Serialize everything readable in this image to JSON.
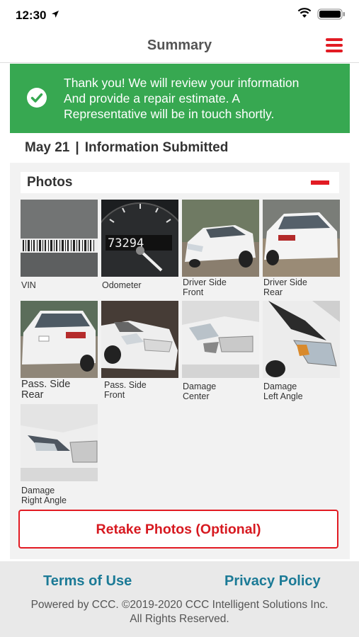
{
  "status_bar": {
    "time": "12:30"
  },
  "nav": {
    "title": "Summary"
  },
  "banner": {
    "lines": [
      "Thank you! We will review your information",
      "And provide a repair estimate. A",
      "Representative will be in touch shortly."
    ]
  },
  "submission": {
    "date": "May 21",
    "separator": "|",
    "status": "Information Submitted"
  },
  "photos": {
    "title": "Photos",
    "items": [
      {
        "line1": "VIN",
        "line2": ""
      },
      {
        "line1": "Odometer",
        "line2": ""
      },
      {
        "line1": "Driver Side",
        "line2": "Front"
      },
      {
        "line1": "Driver Side",
        "line2": "Rear"
      },
      {
        "line1": "Pass. Side",
        "line2": "Rear"
      },
      {
        "line1": "Pass. Side",
        "line2": "Front"
      },
      {
        "line1": "Damage",
        "line2": "Center"
      },
      {
        "line1": "Damage",
        "line2": "Left Angle"
      },
      {
        "line1": "Damage",
        "line2": "Right Angle"
      }
    ],
    "odometer_reading": "73294"
  },
  "retake_button": {
    "label": "Retake Photos (Optional)"
  },
  "footer": {
    "terms": "Terms of Use",
    "privacy": "Privacy Policy",
    "powered_line1": "Powered by CCC. ©2019-2020 CCC Intelligent Solutions Inc.",
    "powered_line2": "All Rights Reserved."
  },
  "colors": {
    "accent_red": "#e21b23",
    "banner_green": "#37a851",
    "link_teal": "#1b7a96"
  }
}
